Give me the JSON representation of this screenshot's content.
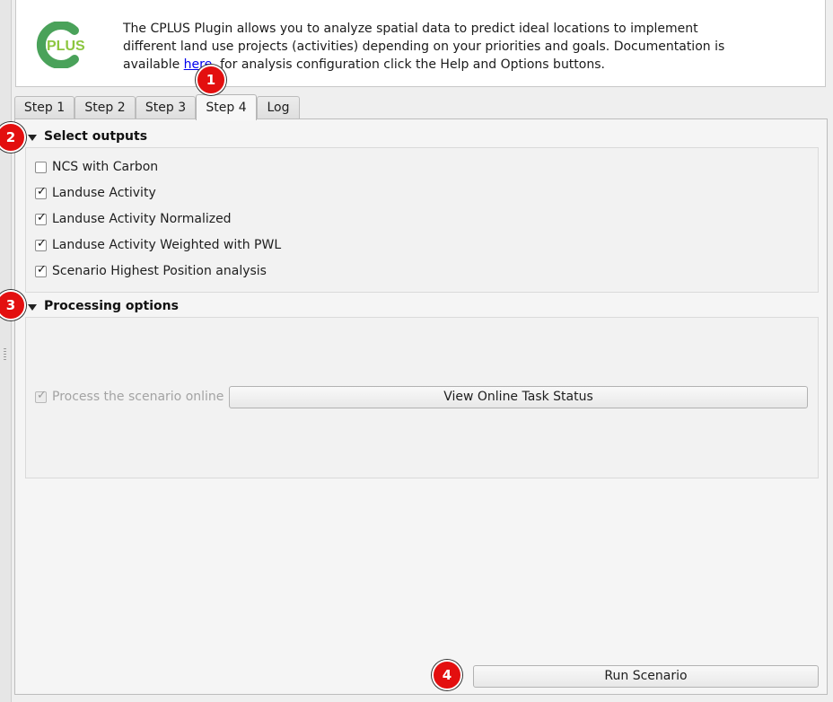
{
  "header": {
    "logo_text": "PLUS",
    "description_before_link": "The CPLUS Plugin allows you to analyze spatial data to predict ideal locations to implement different land use projects (activities) depending on your priorities and goals. Documentation is available ",
    "link_text": "here",
    "description_after_link": ", for analysis configuration click the Help and Options buttons."
  },
  "tabs": [
    {
      "label": "Step 1",
      "active": false
    },
    {
      "label": "Step 2",
      "active": false
    },
    {
      "label": "Step 3",
      "active": false
    },
    {
      "label": "Step 4",
      "active": true
    },
    {
      "label": "Log",
      "active": false
    }
  ],
  "select_outputs": {
    "title": "Select outputs",
    "options": [
      {
        "label": "NCS with Carbon",
        "checked": false
      },
      {
        "label": "Landuse Activity",
        "checked": true
      },
      {
        "label": "Landuse Activity Normalized",
        "checked": true
      },
      {
        "label": "Landuse Activity Weighted with PWL",
        "checked": true
      },
      {
        "label": "Scenario Highest Position analysis",
        "checked": true
      }
    ]
  },
  "processing_options": {
    "title": "Processing options",
    "online_checkbox_label": "Process the scenario online",
    "online_checked": true,
    "online_enabled": false,
    "status_button_label": "View Online Task Status"
  },
  "run_button_label": "Run Scenario",
  "markers": [
    "1",
    "2",
    "3",
    "4"
  ],
  "colors": {
    "marker": "#e30f0f",
    "logo_c": "#4aa25a",
    "logo_plus": "#8cc63f",
    "link": "#0000ee"
  }
}
